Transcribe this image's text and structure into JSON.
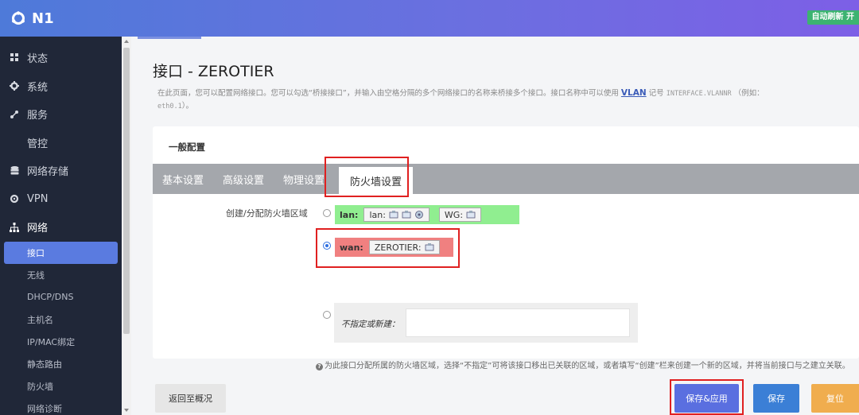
{
  "header": {
    "brand": "N1",
    "auto_refresh": "自动刷新 开"
  },
  "sidebar": {
    "items": [
      {
        "label": "状态",
        "icon": "dashboard-icon"
      },
      {
        "label": "系统",
        "icon": "gear-icon"
      },
      {
        "label": "服务",
        "icon": "services-icon"
      },
      {
        "label": "管控",
        "icon": ""
      },
      {
        "label": "网络存储",
        "icon": "storage-icon"
      },
      {
        "label": "VPN",
        "icon": "vpn-icon"
      },
      {
        "label": "网络",
        "icon": "network-icon"
      }
    ],
    "network_sub": [
      "接口",
      "无线",
      "DHCP/DNS",
      "主机名",
      "IP/MAC绑定",
      "静态路由",
      "防火墙",
      "网络诊断"
    ]
  },
  "page": {
    "title": "接口 - ZEROTIER",
    "desc_part1": "在此页面，您可以配置网络接口。您可以勾选“桥接接口”，并输入由空格分隔的多个网络接口的名称来桥接多个接口。接口名称中可以使用",
    "desc_vlan": "VLAN",
    "desc_part2": "记号",
    "desc_mono1": "INTERFACE.VLANNR",
    "desc_part3": "（例如：",
    "desc_mono2": "eth0.1",
    "desc_part4": "）。"
  },
  "card": {
    "title": "一般配置",
    "tabs": [
      "基本设置",
      "高级设置",
      "物理设置",
      "防火墙设置"
    ],
    "field_label": "创建/分配防火墙区域",
    "zones": {
      "lan": {
        "name": "lan:",
        "chips": [
          "lan:",
          "WG:"
        ]
      },
      "wan": {
        "name": "wan:",
        "chips": [
          "ZEROTIER:"
        ]
      }
    },
    "new_zone_label": "不指定或新建：",
    "new_zone_value": "",
    "help_text": "为此接口分配所属的防火墙区域，选择“不指定”可将该接口移出已关联的区域，或者填写“创建”栏来创建一个新的区域，并将当前接口与之建立关联。"
  },
  "footer": {
    "back": "返回至概况",
    "save_apply": "保存&应用",
    "save": "保存",
    "reset": "复位"
  },
  "colors": {
    "header_start": "#4e7ad9",
    "header_end": "#7d5fe6",
    "sidebar_bg": "#202738",
    "active_item": "#5a7be0",
    "lan_zone": "#90ee90",
    "wan_zone": "#f08080",
    "highlight": "#e02020"
  }
}
